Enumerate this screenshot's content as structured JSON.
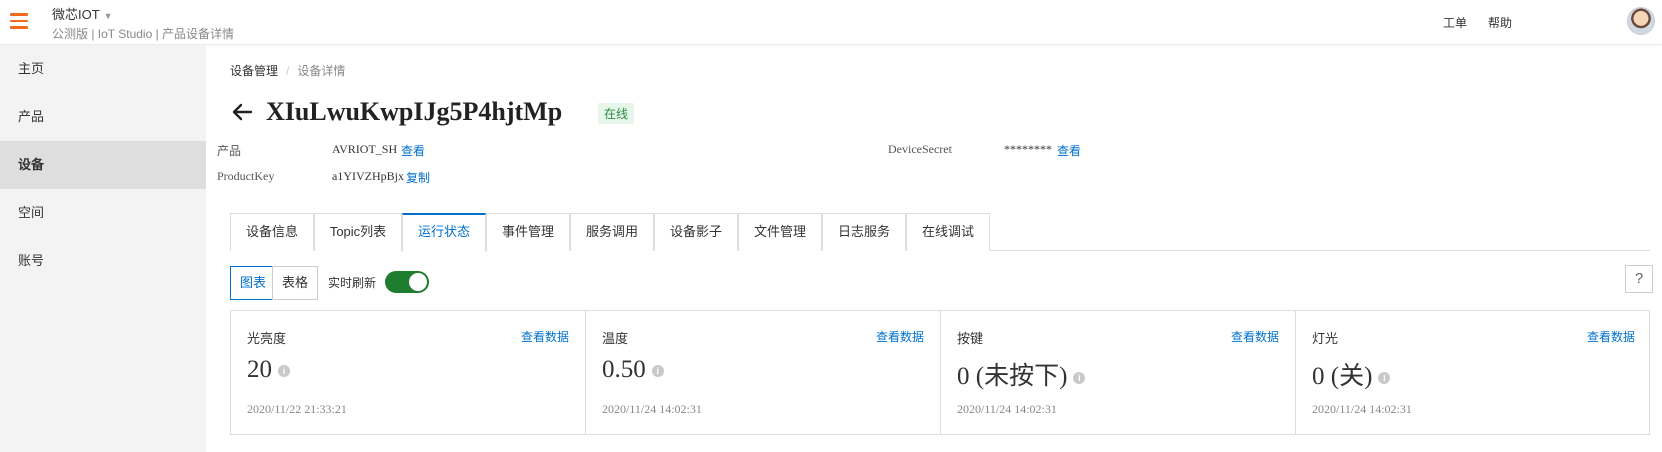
{
  "header": {
    "app_name": "微芯IOT",
    "app_subtitle": "公测版 | IoT Studio | 产品设备详情",
    "links": [
      "工单",
      "帮助"
    ]
  },
  "sidebar": {
    "items": [
      {
        "label": "主页"
      },
      {
        "label": "产品"
      },
      {
        "label": "设备",
        "active": true
      },
      {
        "label": "空间"
      },
      {
        "label": "账号"
      }
    ]
  },
  "breadcrumb": {
    "home": "设备管理",
    "current": "设备详情"
  },
  "device": {
    "name": "XIuLwuKwpIJg5P4hjtMp",
    "status": "在线",
    "product_label": "产品",
    "product_value": "AVRIOT_SH",
    "product_link": "查看",
    "productkey_label": "ProductKey",
    "productkey_value": "a1YIVZHpBjx",
    "productkey_link": "复制",
    "secret_label": "DeviceSecret",
    "secret_value": "********",
    "secret_link": "查看"
  },
  "tabs": [
    {
      "label": "设备信息"
    },
    {
      "label": "Topic列表"
    },
    {
      "label": "运行状态",
      "active": true
    },
    {
      "label": "事件管理"
    },
    {
      "label": "服务调用"
    },
    {
      "label": "设备影子"
    },
    {
      "label": "文件管理"
    },
    {
      "label": "日志服务"
    },
    {
      "label": "在线调试"
    }
  ],
  "view": {
    "chart_label": "图表",
    "table_label": "表格",
    "realtime_label": "实时刷新",
    "realtime_on": true,
    "help_label": "?"
  },
  "cards": [
    {
      "name": "光亮度",
      "link": "查看数据",
      "value": "20",
      "time": "2020/11/22 21:33:21"
    },
    {
      "name": "温度",
      "link": "查看数据",
      "value": "0.50",
      "time": "2020/11/24 14:02:31"
    },
    {
      "name": "按键",
      "link": "查看数据",
      "value": "0 (未按下)",
      "time": "2020/11/24 14:02:31"
    },
    {
      "name": "灯光",
      "link": "查看数据",
      "value": "0 (关)",
      "time": "2020/11/24 14:02:31"
    }
  ],
  "colors": {
    "accent": "#0070cc",
    "menu": "#f26b1d",
    "toggle_on": "#1e7d2e",
    "online_bg": "#e6f6ea",
    "online_text": "#2c8a40"
  }
}
